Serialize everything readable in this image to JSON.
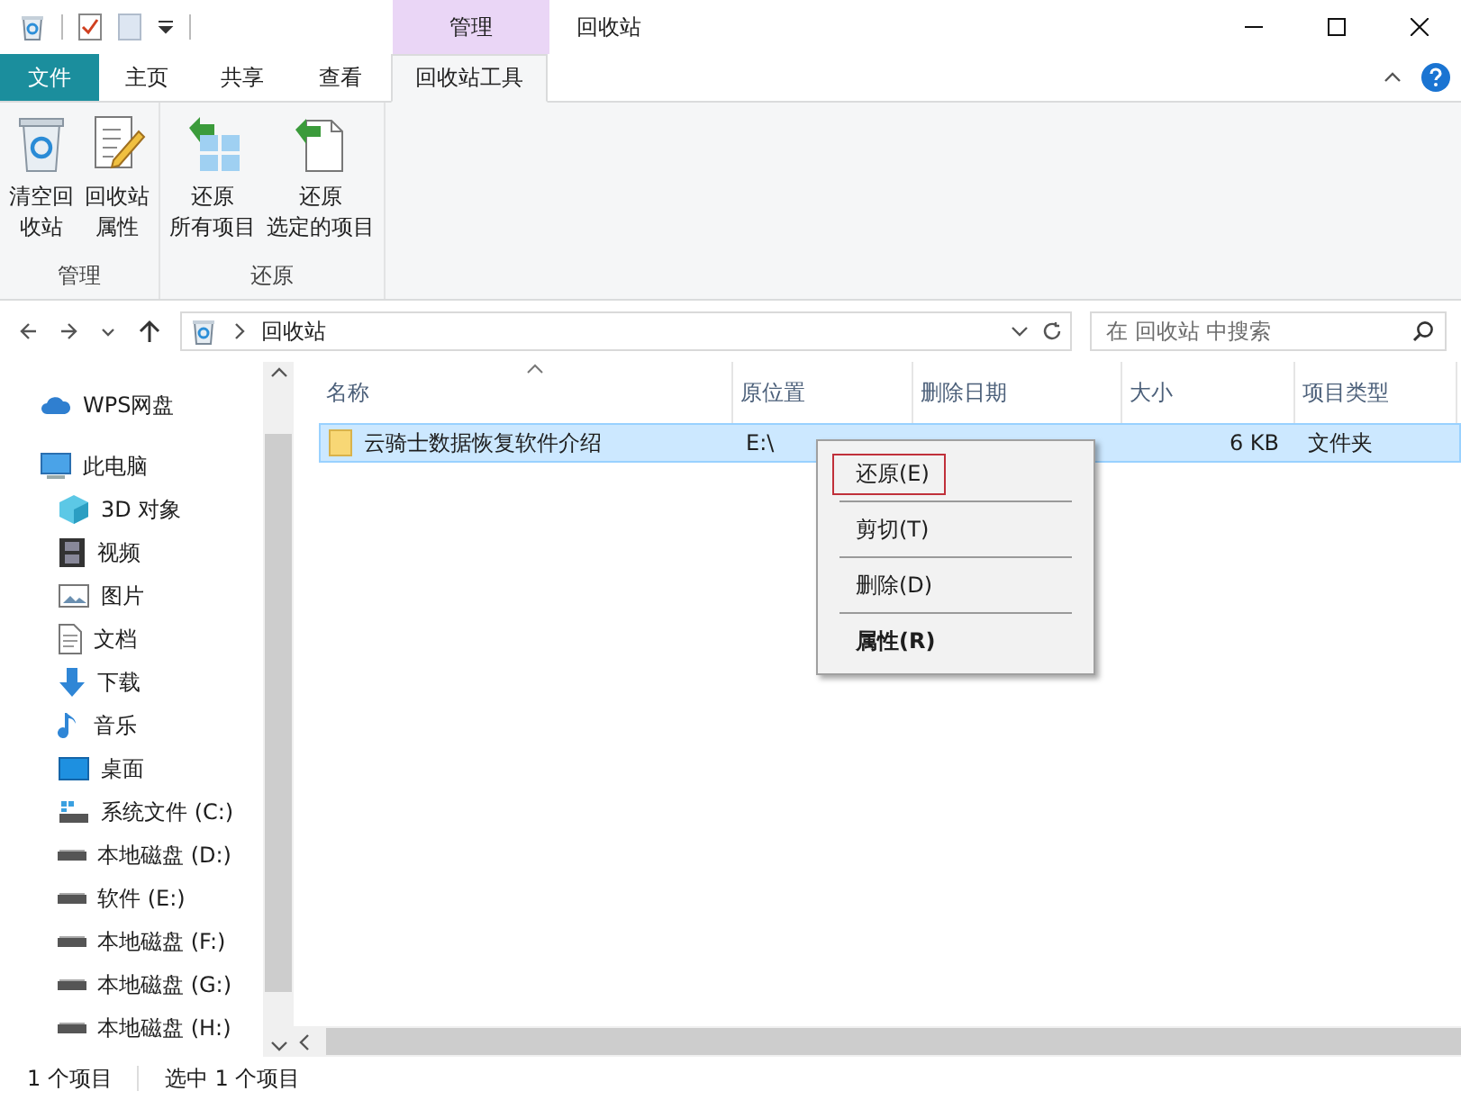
{
  "window": {
    "title": "回收站",
    "contextual_group": "管理"
  },
  "ribbon_tabs": [
    {
      "label": "文件",
      "kind": "file",
      "selected": false
    },
    {
      "label": "主页",
      "kind": "tab",
      "selected": false
    },
    {
      "label": "共享",
      "kind": "tab",
      "selected": false
    },
    {
      "label": "查看",
      "kind": "tab",
      "selected": false
    },
    {
      "label": "回收站工具",
      "kind": "tab",
      "selected": true
    }
  ],
  "ribbon_groups": [
    {
      "label": "管理",
      "buttons": [
        {
          "lines": [
            "清空回",
            "收站"
          ]
        },
        {
          "lines": [
            "回收站",
            "属性"
          ]
        }
      ]
    },
    {
      "label": "还原",
      "buttons": [
        {
          "lines": [
            "还原",
            "所有项目"
          ]
        },
        {
          "lines": [
            "还原",
            "选定的项目"
          ]
        }
      ]
    }
  ],
  "address_bar": {
    "path": "回收站"
  },
  "search": {
    "placeholder": "在 回收站 中搜索"
  },
  "sidebar": {
    "items": [
      {
        "label": "WPS网盘"
      },
      {
        "label": "此电脑",
        "children": [
          {
            "label": "3D 对象"
          },
          {
            "label": "视频"
          },
          {
            "label": "图片"
          },
          {
            "label": "文档"
          },
          {
            "label": "下载"
          },
          {
            "label": "音乐"
          },
          {
            "label": "桌面"
          },
          {
            "label": "系统文件 (C:)"
          },
          {
            "label": "本地磁盘 (D:)"
          },
          {
            "label": "软件 (E:)"
          },
          {
            "label": "本地磁盘 (F:)"
          },
          {
            "label": "本地磁盘 (G:)"
          },
          {
            "label": "本地磁盘 (H:)"
          }
        ]
      }
    ]
  },
  "table": {
    "columns": [
      {
        "label": "名称",
        "sorted": true
      },
      {
        "label": "原位置",
        "sorted": false
      },
      {
        "label": "删除日期",
        "sorted": false
      },
      {
        "label": "大小",
        "sorted": false
      },
      {
        "label": "项目类型",
        "sorted": false
      }
    ],
    "rows": [
      {
        "name": "云骑士数据恢复软件介绍",
        "location": "E:\\",
        "size": "6 KB",
        "type": "文件夹",
        "selected": true
      }
    ]
  },
  "context_menu": {
    "items": [
      {
        "label": "还原(E)",
        "selected": true,
        "bold": false
      },
      {
        "label": "剪切(T)",
        "selected": false,
        "bold": false
      },
      {
        "label": "删除(D)",
        "selected": false,
        "bold": false
      },
      {
        "label": "属性(R)",
        "selected": false,
        "bold": true
      }
    ]
  },
  "status_bar": {
    "item_count": "1 个项目",
    "selection": "选中 1 个项目"
  }
}
